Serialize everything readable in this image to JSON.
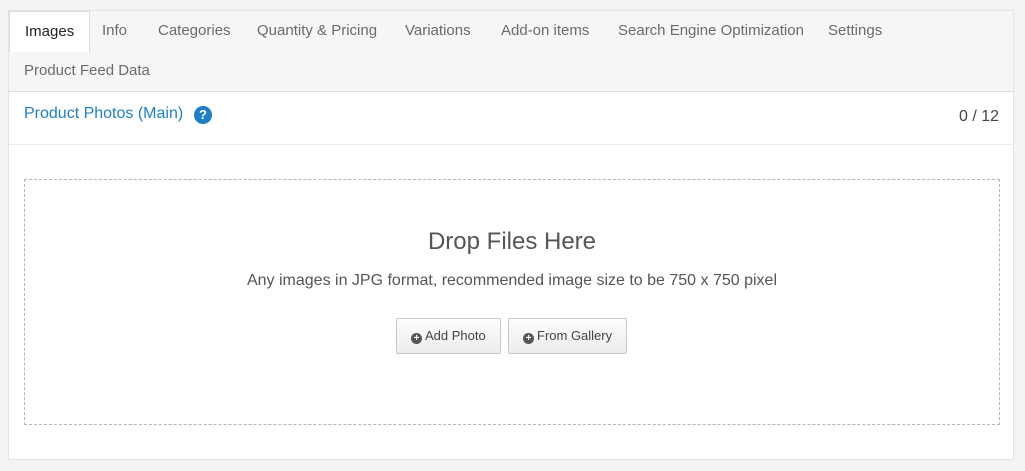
{
  "tabs": [
    {
      "label": "Images",
      "active": true
    },
    {
      "label": "Info"
    },
    {
      "label": "Categories"
    },
    {
      "label": "Quantity & Pricing"
    },
    {
      "label": "Variations"
    },
    {
      "label": "Add-on items"
    },
    {
      "label": "Search Engine Optimization"
    },
    {
      "label": "Settings"
    },
    {
      "label": "Product Feed Data"
    }
  ],
  "section": {
    "title": "Product Photos (Main)",
    "help_icon": "question-circle-icon",
    "help_glyph": "?",
    "count": "0 / 12"
  },
  "dropzone": {
    "title": "Drop Files Here",
    "subtitle": "Any images in JPG format, recommended image size to be 750 x 750 pixel",
    "add_photo_label": "Add Photo",
    "from_gallery_label": "From Gallery",
    "button_icon": "plus-circle-icon",
    "button_glyph": "+"
  },
  "colors": {
    "accent": "#1f7fc6",
    "page_background": "#f3f3f3"
  }
}
